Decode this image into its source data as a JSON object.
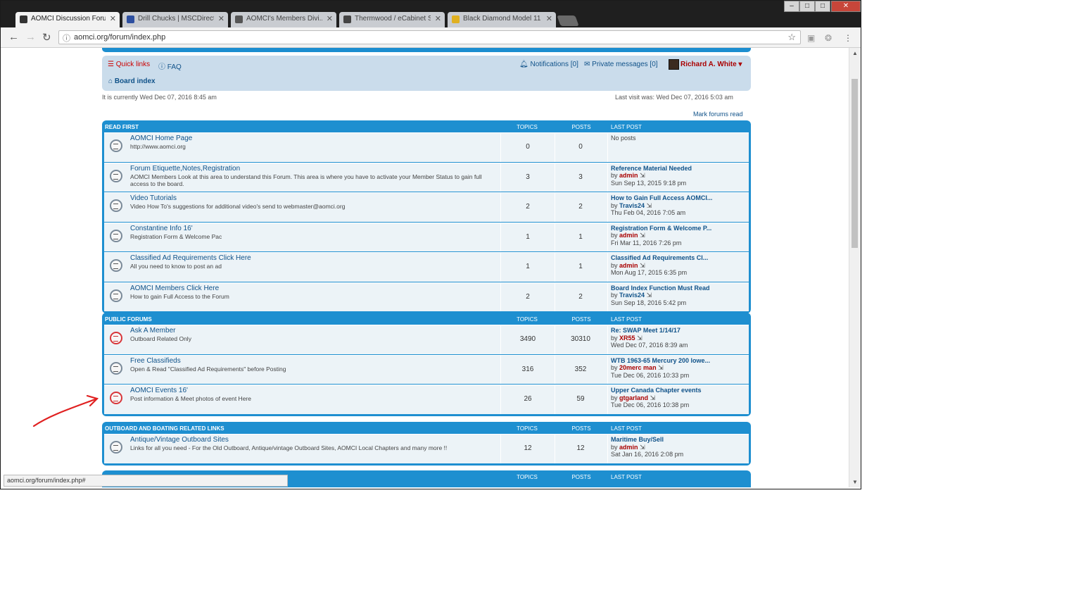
{
  "browser": {
    "tabs": [
      {
        "title": "AOMCI Discussion Forum",
        "active": true,
        "favicon_color": "#333333"
      },
      {
        "title": "Drill Chucks | MSCDirect",
        "active": false,
        "favicon_color": "#2d4fa0"
      },
      {
        "title": "AOMCI's Members Divi...",
        "active": false,
        "favicon_color": "#555555"
      },
      {
        "title": "Thermwood / eCabinet S",
        "active": false,
        "favicon_color": "#444444"
      },
      {
        "title": "Black Diamond Model 11",
        "active": false,
        "favicon_color": "#e0b020"
      }
    ],
    "window_controls": {
      "minimize": "–",
      "maximize": "□",
      "close": "✕"
    },
    "url": "aomci.org/forum/index.php",
    "status_url": "aomci.org/forum/index.php#"
  },
  "navbar": {
    "quick_links": "Quick links",
    "faq": "FAQ",
    "board_index": "Board index",
    "notifications": "Notifications [0]",
    "private_messages": "Private messages [0]",
    "username": "Richard A. White ▾"
  },
  "info": {
    "current_time": "It is currently Wed Dec 07, 2016 8:45 am",
    "last_visit": "Last visit was: Wed Dec 07, 2016 5:03 am",
    "mark_read": "Mark forums read"
  },
  "headers": {
    "topics": "TOPICS",
    "posts": "POSTS",
    "last_post": "LAST POST"
  },
  "categories": [
    {
      "name": "READ FIRST",
      "forums": [
        {
          "title": "AOMCI Home Page",
          "desc": "http://www.aomci.org",
          "topics": "0",
          "posts": "0",
          "last_title": "No posts",
          "last_by": "",
          "last_author": "",
          "last_date": "",
          "unread": false
        },
        {
          "title": "Forum Etiquette,Notes,Registration",
          "desc": "AOMCI Members Look at this area to understand this Forum. This area is where you have to activate your Member Status to gain full access to the board.",
          "topics": "3",
          "posts": "3",
          "last_title": "Reference Material Needed",
          "last_by": "by",
          "last_author": "admin",
          "last_date": "Sun Sep 13, 2015 9:18 pm",
          "unread": false
        },
        {
          "title": "Video Tutorials",
          "desc": "Video How To's suggestions for additional video's send to webmaster@aomci.org",
          "topics": "2",
          "posts": "2",
          "last_title": "How to Gain Full Access AOMCI...",
          "last_by": "by",
          "last_author": "Travis24",
          "last_date": "Thu Feb 04, 2016 7:05 am",
          "unread": false
        },
        {
          "title": "Constantine Info 16'",
          "desc": "Registration Form & Welcome Pac",
          "topics": "1",
          "posts": "1",
          "last_title": "Registration Form & Welcome P...",
          "last_by": "by",
          "last_author": "admin",
          "last_date": "Fri Mar 11, 2016 7:26 pm",
          "unread": false
        },
        {
          "title": "Classified Ad Requirements Click Here",
          "desc": "All you need to know to post an ad",
          "topics": "1",
          "posts": "1",
          "last_title": "Classified Ad Requirements Cl...",
          "last_by": "by",
          "last_author": "admin",
          "last_date": "Mon Aug 17, 2015 6:35 pm",
          "unread": false
        },
        {
          "title": "AOMCI Members Click Here",
          "desc": "How to gain Full Access to the Forum",
          "topics": "2",
          "posts": "2",
          "last_title": "Board Index Function Must Read",
          "last_by": "by",
          "last_author": "Travis24",
          "last_date": "Sun Sep 18, 2016 5:42 pm",
          "unread": false
        }
      ]
    },
    {
      "name": "PUBLIC FORUMS",
      "forums": [
        {
          "title": "Ask A Member",
          "desc": "Outboard Related Only",
          "topics": "3490",
          "posts": "30310",
          "last_title": "Re: SWAP Meet 1/14/17",
          "last_by": "by",
          "last_author": "XR55",
          "last_date": "Wed Dec 07, 2016 8:39 am",
          "unread": true
        },
        {
          "title": "Free Classifieds",
          "desc": "Open & Read \"Classified Ad Requirements\" before Posting",
          "topics": "316",
          "posts": "352",
          "last_title": "WTB 1963-65 Mercury 200 lowe...",
          "last_by": "by",
          "last_author": "20merc man",
          "last_date": "Tue Dec 06, 2016 10:33 pm",
          "unread": false
        },
        {
          "title": "AOMCI Events 16'",
          "desc": "Post information & Meet photos of event Here",
          "topics": "26",
          "posts": "59",
          "last_title": "Upper Canada Chapter events",
          "last_by": "by",
          "last_author": "gtgarland",
          "last_date": "Tue Dec 06, 2016 10:38 pm",
          "unread": true
        }
      ]
    },
    {
      "name": "OUTBOARD AND BOATING RELATED LINKS",
      "forums": [
        {
          "title": "Antique/Vintage Outboard Sites",
          "desc": "Links for all you need - For the Old Outboard, Antique/vintage Outboard Sites, AOMCI Local Chapters and many more !!",
          "topics": "12",
          "posts": "12",
          "last_title": "Maritime Buy/Sell",
          "last_by": "by",
          "last_author": "admin",
          "last_date": "Sat Jan 16, 2016 2:08 pm",
          "unread": false
        }
      ]
    },
    {
      "name": "",
      "forums": []
    }
  ],
  "annotation": {
    "arrow_color": "#e02020"
  }
}
